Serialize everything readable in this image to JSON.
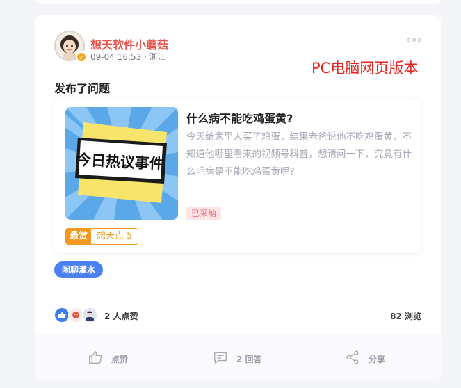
{
  "author": {
    "name": "想天软件小蘑菇",
    "time": "09-04 16:53",
    "location": "浙江"
  },
  "watermark": "PC电脑网页版本",
  "post": {
    "title": "发布了问题"
  },
  "question": {
    "title": "什么病不能吃鸡蛋黄?",
    "description": "今天给家里人买了鸡蛋，结果老爸说他不吃鸡蛋黄，不知道他哪里看来的视频号科普，想请问一下，究竟有什么毛病是不能吃鸡蛋黄呢?",
    "thumbnail_text": "今日热议事件",
    "status": "已采纳",
    "reward_label": "悬赏",
    "reward_value": "想天点 5"
  },
  "tag": "闲聊灌水",
  "stats": {
    "likes": "2 人点赞",
    "views": "82 浏览"
  },
  "actions": {
    "like": "点赞",
    "reply": "2 回答",
    "share": "分享"
  },
  "colors": {
    "author": "#e8554e",
    "watermark": "#e8231f",
    "tag": "#4a80f0",
    "reward": "#f39a1e",
    "adopted_bg": "#fde4e6",
    "adopted_text": "#f06e79"
  },
  "icons": {
    "more": "more-horizontal-icon",
    "like": "thumb-up-icon",
    "reply": "comment-icon",
    "share": "share-icon",
    "verified": "verified-badge-icon"
  }
}
